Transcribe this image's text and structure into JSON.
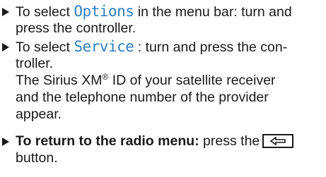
{
  "steps": [
    {
      "lines": [
        {
          "before": "To select ",
          "term": "Options",
          "after": " in the menu bar: turn and"
        },
        {
          "text": "press the controller."
        }
      ]
    },
    {
      "lines": [
        {
          "before": "To select ",
          "term": "Service",
          "after": " : turn and press the con-"
        },
        {
          "text": "troller."
        },
        {
          "before": "The Sirius XM",
          "sup": "®",
          "after": " ID of your satellite receiver"
        },
        {
          "text": "and the telephone number of the provider"
        },
        {
          "text": "appear."
        }
      ]
    },
    {
      "bold_lead": "To return to the radio menu:",
      "after_bold": " press the",
      "button_icon": "back-arrow-icon",
      "continuation": "button."
    }
  ],
  "colors": {
    "term": "#2f7fc0",
    "text": "#1a1a1a"
  }
}
